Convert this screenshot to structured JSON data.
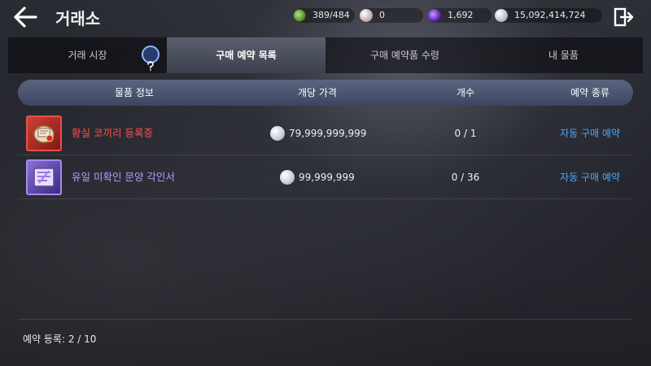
{
  "header": {
    "title": "거래소",
    "back_icon": "back-arrow-icon",
    "exit_icon": "exit-door-icon"
  },
  "currencies": [
    {
      "name": "energy",
      "icon": "energy-icon",
      "value": "389/484",
      "color": "#6fb23a"
    },
    {
      "name": "pearl",
      "icon": "pearl-icon",
      "value": "0",
      "color": "#e8dede"
    },
    {
      "name": "crystal",
      "icon": "crystal-icon",
      "value": "1,692",
      "color": "#6a2fd0"
    },
    {
      "name": "silver",
      "icon": "silver-coin-icon",
      "value": "15,092,414,724",
      "color": "#c4ced8"
    }
  ],
  "tabs": [
    {
      "label": "거래 시장",
      "active": false
    },
    {
      "label": "구매 예약 목록",
      "active": true
    },
    {
      "label": "구매 예약품 수령",
      "active": false
    },
    {
      "label": "내 물품",
      "active": false
    }
  ],
  "table": {
    "headers": {
      "item": "물품 정보",
      "price": "개당 가격",
      "count": "개수",
      "type": "예약 종류"
    },
    "rows": [
      {
        "name": "황실 코끼리 등록증",
        "name_color": "#ff4f4a",
        "icon": "elephant-certificate-icon",
        "price": "79,999,999,999",
        "count": "0 / 1",
        "type": "자동 구매 예약"
      },
      {
        "name": "유일 미확인 문양 각인서",
        "name_color": "#b59bff",
        "icon": "engraving-scroll-icon",
        "price": "99,999,999",
        "count": "0 / 36",
        "type": "자동 구매 예약"
      }
    ]
  },
  "footer": {
    "registration": "예약 등록: 2 / 10"
  },
  "accent_colors": {
    "link_blue": "#4da9ff",
    "header_bar": "#4a5470"
  }
}
